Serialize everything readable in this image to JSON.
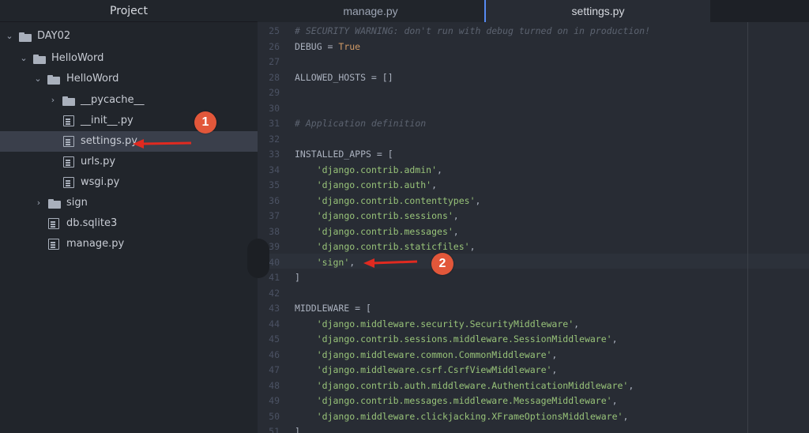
{
  "sidebar": {
    "title": "Project",
    "items": [
      {
        "label": "DAY02",
        "type": "folder",
        "expanded": true
      },
      {
        "label": "HelloWord",
        "type": "folder",
        "expanded": true
      },
      {
        "label": "HelloWord",
        "type": "folder",
        "expanded": true
      },
      {
        "label": "__pycache__",
        "type": "folder",
        "expanded": false
      },
      {
        "label": "__init__.py",
        "type": "file"
      },
      {
        "label": "settings.py",
        "type": "file",
        "selected": true
      },
      {
        "label": "urls.py",
        "type": "file"
      },
      {
        "label": "wsgi.py",
        "type": "file"
      },
      {
        "label": "sign",
        "type": "folder",
        "expanded": false
      },
      {
        "label": "db.sqlite3",
        "type": "file"
      },
      {
        "label": "manage.py",
        "type": "file"
      }
    ]
  },
  "tabs": {
    "manage": "manage.py",
    "settings": "settings.py"
  },
  "annotations": {
    "one": "1",
    "two": "2",
    "color": "#e2573a"
  },
  "code": {
    "lines": [
      {
        "n": "25",
        "t": "# SECURITY WARNING: don't run with debug turned on in production!"
      },
      {
        "n": "26",
        "a": "DEBUG = ",
        "b": "True"
      },
      {
        "n": "27",
        "t": ""
      },
      {
        "n": "28",
        "t": "ALLOWED_HOSTS = []"
      },
      {
        "n": "29",
        "t": ""
      },
      {
        "n": "30",
        "t": ""
      },
      {
        "n": "31",
        "t": "# Application definition"
      },
      {
        "n": "32",
        "t": ""
      },
      {
        "n": "33",
        "t": "INSTALLED_APPS = ["
      },
      {
        "n": "34",
        "s": "'django.contrib.admin'"
      },
      {
        "n": "35",
        "s": "'django.contrib.auth'"
      },
      {
        "n": "36",
        "s": "'django.contrib.contenttypes'"
      },
      {
        "n": "37",
        "s": "'django.contrib.sessions'"
      },
      {
        "n": "38",
        "s": "'django.contrib.messages'"
      },
      {
        "n": "39",
        "s": "'django.contrib.staticfiles'"
      },
      {
        "n": "40",
        "s": "'sign'"
      },
      {
        "n": "41",
        "t": "]"
      },
      {
        "n": "42",
        "t": ""
      },
      {
        "n": "43",
        "t": "MIDDLEWARE = ["
      },
      {
        "n": "44",
        "s": "'django.middleware.security.SecurityMiddleware'"
      },
      {
        "n": "45",
        "s": "'django.contrib.sessions.middleware.SessionMiddleware'"
      },
      {
        "n": "46",
        "s": "'django.middleware.common.CommonMiddleware'"
      },
      {
        "n": "47",
        "s": "'django.middleware.csrf.CsrfViewMiddleware'"
      },
      {
        "n": "48",
        "s": "'django.contrib.auth.middleware.AuthenticationMiddleware'"
      },
      {
        "n": "49",
        "s": "'django.contrib.messages.middleware.MessageMiddleware'"
      },
      {
        "n": "50",
        "s": "'django.middleware.clickjacking.XFrameOptionsMiddleware'"
      },
      {
        "n": "51",
        "t": "]"
      }
    ]
  },
  "colors": {
    "comment": "#5c6370",
    "string": "#98c379",
    "constant": "#d19a66",
    "text": "#abb2bf",
    "selection_tab_accent": "#568af2"
  }
}
